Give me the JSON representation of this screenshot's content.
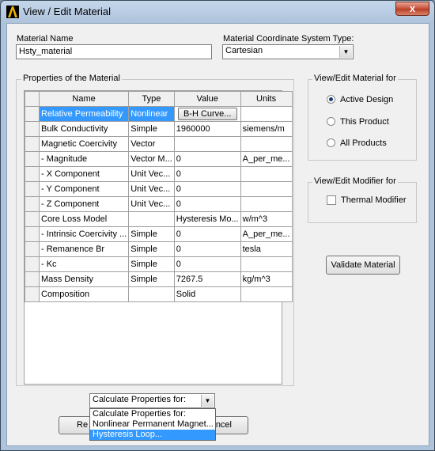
{
  "window": {
    "title": "View / Edit Material",
    "close_glyph": "x"
  },
  "material_name": {
    "label": "Material Name",
    "value": "Hsty_material"
  },
  "coord_system": {
    "label": "Material Coordinate System Type:",
    "value": "Cartesian"
  },
  "properties": {
    "group_label": "Properties of the Material",
    "columns": [
      "Name",
      "Type",
      "Value",
      "Units"
    ],
    "rows": [
      {
        "name": "Relative Permeability",
        "type": "Nonlinear",
        "value": "B-H Curve...",
        "units": ""
      },
      {
        "name": "Bulk Conductivity",
        "type": "Simple",
        "value": "1960000",
        "units": "siemens/m"
      },
      {
        "name": "Magnetic Coercivity",
        "type": "Vector",
        "value": "",
        "units": ""
      },
      {
        "name": "- Magnitude",
        "type": "Vector M...",
        "value": "0",
        "units": "A_per_me..."
      },
      {
        "name": "- X Component",
        "type": "Unit Vec...",
        "value": "0",
        "units": ""
      },
      {
        "name": "- Y Component",
        "type": "Unit Vec...",
        "value": "0",
        "units": ""
      },
      {
        "name": "- Z Component",
        "type": "Unit Vec...",
        "value": "0",
        "units": ""
      },
      {
        "name": "Core Loss Model",
        "type": "",
        "value": "Hysteresis Mo...",
        "units": "w/m^3"
      },
      {
        "name": "- Intrinsic Coercivity ...",
        "type": "Simple",
        "value": "0",
        "units": "A_per_me..."
      },
      {
        "name": "- Remanence Br",
        "type": "Simple",
        "value": "0",
        "units": "tesla"
      },
      {
        "name": "- Kc",
        "type": "Simple",
        "value": "0",
        "units": ""
      },
      {
        "name": "Mass Density",
        "type": "Simple",
        "value": "7267.5",
        "units": "kg/m^3"
      },
      {
        "name": "Composition",
        "type": "",
        "value": "Solid",
        "units": ""
      }
    ]
  },
  "view_edit_for": {
    "group_label": "View/Edit Material for",
    "options": [
      "Active Design",
      "This Product",
      "All Products"
    ],
    "selected": "Active Design"
  },
  "modifier": {
    "group_label": "View/Edit Modifier for",
    "thermal_label": "Thermal Modifier"
  },
  "validate_button": "Validate Material",
  "calc_props": {
    "selected": "Calculate Properties for:",
    "options": [
      "Calculate Properties for:",
      "Nonlinear Permanent Magnet...",
      "Hysteresis Loop..."
    ],
    "highlighted": "Hysteresis Loop..."
  },
  "bottom_buttons": {
    "left_partial": "Re",
    "right_partial": "ncel"
  },
  "icons": {
    "app": "ansys-logo-icon",
    "close": "close-icon",
    "dropdown": "chevron-down-icon"
  },
  "colors": {
    "selection": "#3399ff",
    "close_button": "#c7503a",
    "logo": "#f2b400"
  }
}
